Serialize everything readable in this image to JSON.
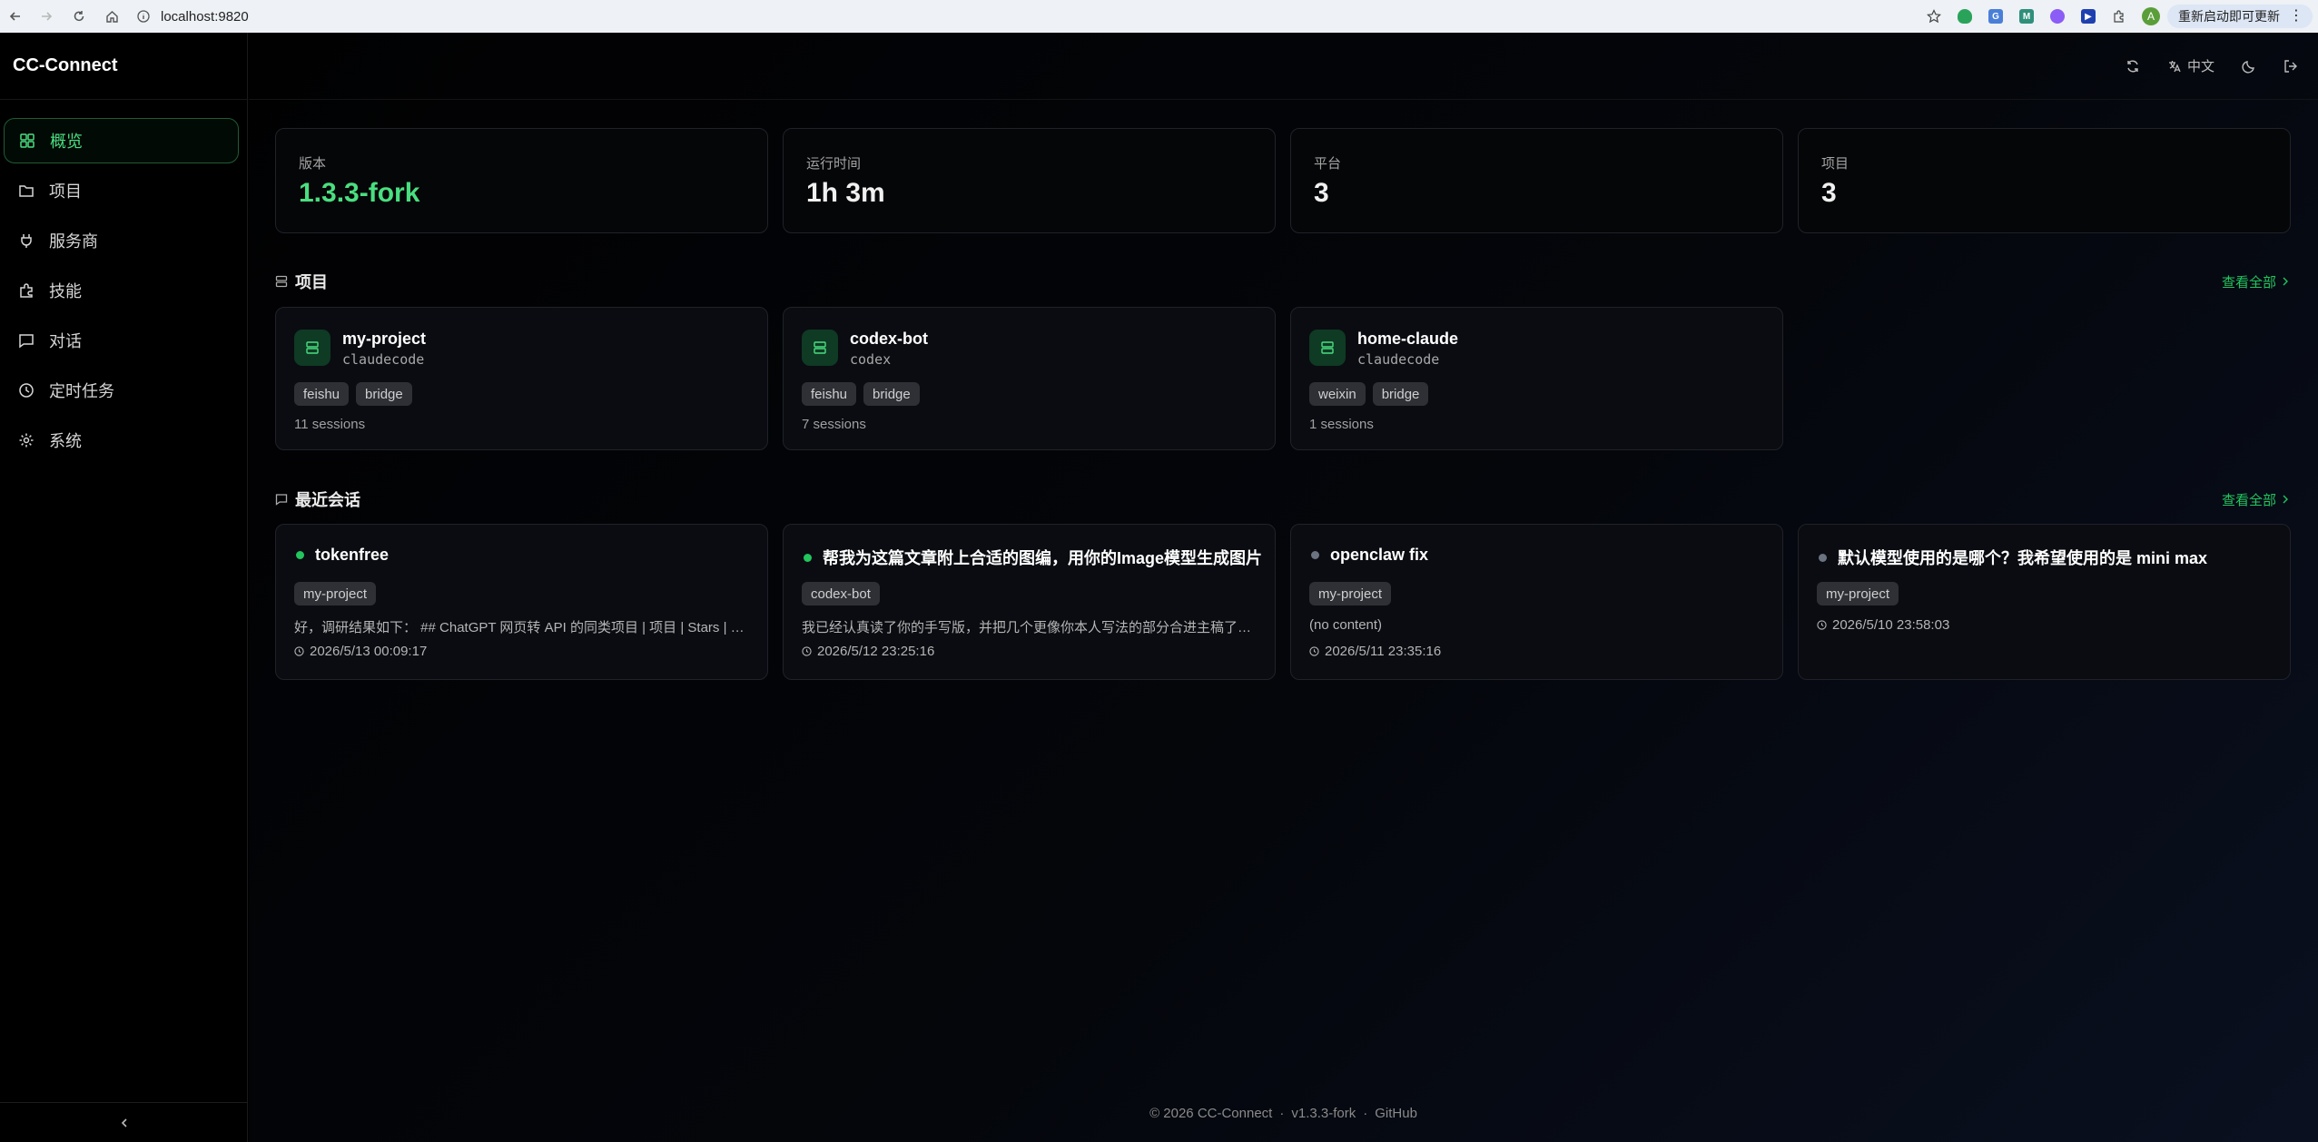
{
  "browser": {
    "url": "localhost:9820",
    "update_label": "重新启动即可更新",
    "profile_initial": "A"
  },
  "app": {
    "name": "CC-Connect"
  },
  "sidebar": {
    "items": [
      {
        "label": "概览",
        "icon": "dashboard-icon",
        "active": true
      },
      {
        "label": "项目",
        "icon": "folder-icon"
      },
      {
        "label": "服务商",
        "icon": "plug-icon"
      },
      {
        "label": "技能",
        "icon": "puzzle-icon"
      },
      {
        "label": "对话",
        "icon": "chat-icon"
      },
      {
        "label": "定时任务",
        "icon": "clock-icon"
      },
      {
        "label": "系统",
        "icon": "gear-icon"
      }
    ]
  },
  "topbar": {
    "language": "中文"
  },
  "stats": [
    {
      "label": "版本",
      "value": "1.3.3-fork",
      "color": "#4ade80"
    },
    {
      "label": "运行时间",
      "value": "1h 3m"
    },
    {
      "label": "平台",
      "value": "3"
    },
    {
      "label": "项目",
      "value": "3"
    }
  ],
  "projects_section": {
    "title": "项目",
    "view_all": "查看全部",
    "items": [
      {
        "name": "my-project",
        "agent": "claudecode",
        "tags": [
          "feishu",
          "bridge"
        ],
        "sessions": "11 sessions"
      },
      {
        "name": "codex-bot",
        "agent": "codex",
        "tags": [
          "feishu",
          "bridge"
        ],
        "sessions": "7 sessions"
      },
      {
        "name": "home-claude",
        "agent": "claudecode",
        "tags": [
          "weixin",
          "bridge"
        ],
        "sessions": "1 sessions"
      }
    ]
  },
  "sessions_section": {
    "title": "最近会话",
    "view_all": "查看全部",
    "items": [
      {
        "title": "tokenfree",
        "status": "active",
        "project": "my-project",
        "preview": "好，调研结果如下： ## ChatGPT 网页转 API 的同类项目 | 项目 | Stars | 类型 | 说明 |",
        "time": "2026/5/13 00:09:17"
      },
      {
        "title": "帮我为这篇文章附上合适的图编，用你的Image模型生成图片",
        "status": "active",
        "project": "codex-bot",
        "preview": "我已经认真读了你的手写版，并把几个更像你本人写法的部分合进主稿了，现在这版已经完整",
        "time": "2026/5/12 23:25:16"
      },
      {
        "title": "openclaw fix",
        "status": "idle",
        "project": "my-project",
        "preview": "(no content)",
        "time": "2026/5/11 23:35:16"
      },
      {
        "title": "默认模型使用的是哪个？我希望使用的是 mini max",
        "status": "idle",
        "project": "my-project",
        "preview": "",
        "time": "2026/5/10 23:58:03"
      }
    ]
  },
  "footer": {
    "copyright": "© 2026 CC-Connect",
    "version": "v1.3.3-fork",
    "link": "GitHub"
  },
  "colors": {
    "accent": "#4ade80",
    "active_dot": "#22c55e",
    "idle_dot": "#6b7280"
  }
}
